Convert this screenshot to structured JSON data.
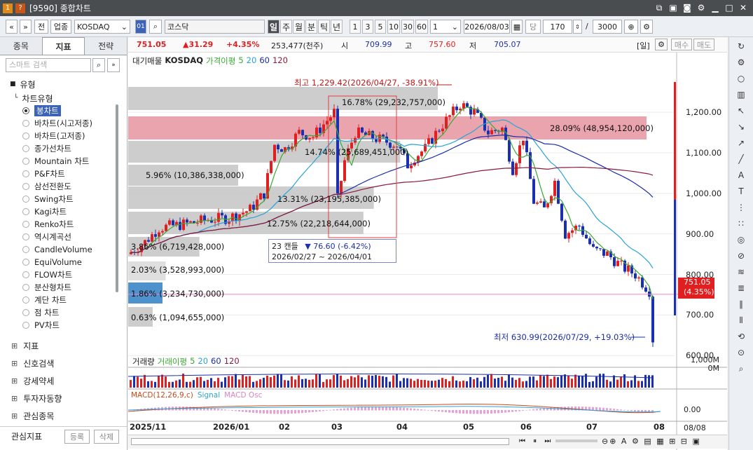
{
  "window": {
    "title": "[9590] 종합차트",
    "num": "1",
    "q": "?"
  },
  "toolbar": {
    "nav_left": "«",
    "nav_down": "»",
    "prev_btn": "전",
    "sector_btn": "업종",
    "market": "KOSDAQ",
    "code_badge": "01",
    "name": "코스닥",
    "periods": [
      "일",
      "주",
      "월",
      "분",
      "틱",
      "년"
    ],
    "nums": [
      "1",
      "3",
      "5",
      "10",
      "30",
      "60"
    ],
    "count": "1",
    "date": "2026/08/03",
    "unit": "당",
    "count2": "170",
    "slash": "/",
    "total": "3000"
  },
  "sidebar": {
    "tabs": [
      "종목",
      "지표",
      "전략"
    ],
    "search_placeholder": "스마트 검색",
    "group_type": "유형",
    "chart_type": "차트유형",
    "chart_items": [
      "봉차트",
      "바차트(시고저종)",
      "바차트(고저종)",
      "종가선차트",
      "Mountain 차트",
      "P&F차트",
      "삼선전환도",
      "Swing차트",
      "Kagi차트",
      "Renko차트",
      "역시계곡선",
      "CandleVolume",
      "EquiVolume",
      "FLOW차트",
      "분산형차트",
      "계단 차트",
      "점 차트",
      "PV차트"
    ],
    "sections": [
      "지표",
      "신호검색",
      "강세약세",
      "투자자동향",
      "관심종목"
    ],
    "bottom_label": "관심지표",
    "register": "등록",
    "delete": "삭제"
  },
  "quote": {
    "price": "751.05",
    "change": "▲31.29",
    "pct": "+4.35%",
    "volume": "253,477(천주)",
    "open_label": "시",
    "open": "709.99",
    "high_label": "고",
    "high": "757.60",
    "low_label": "저",
    "low": "705.07",
    "period": "[일]",
    "buy": "매수",
    "sell": "매도"
  },
  "legend": {
    "main": "대기매물",
    "code": "KOSDAQ",
    "ma_title": "가격이평",
    "ma5": "5",
    "ma20": "20",
    "ma60": "60",
    "ma120": "120"
  },
  "vol_legend": {
    "title": "거래량",
    "ma_title": "거래이평",
    "ma5": "5",
    "ma20": "20",
    "ma60": "60",
    "ma120": "120",
    "y1": "1,000M",
    "y0": "0M"
  },
  "macd_legend": {
    "title": "MACD(12,26,9,c)",
    "signal": "Signal",
    "osc": "MACD Osc",
    "y": "0.00"
  },
  "annotations": {
    "high": "최고 1,229.42(2026/04/27, -38.91%)",
    "low": "최저 630.99(2026/07/29, +19.03%)",
    "tip_count": "23 캔들",
    "tip_change": "▼ 76.60 (-6.42%)",
    "tip_range": "2026/02/27 ~ 2026/04/01",
    "price_tag": "751.05",
    "price_tag_pct": "(4.35%)"
  },
  "profile": [
    {
      "label": "16.78% (29,232,757,000)",
      "pct": 16.78
    },
    {
      "label": "28.09% (48,954,120,000)",
      "pct": 28.09
    },
    {
      "label": "14.74% (25,689,451,000)",
      "pct": 14.74
    },
    {
      "label": "5.96% (10,386,338,000)",
      "pct": 5.96
    },
    {
      "label": "13.31% (23,195,385,000)",
      "pct": 13.31
    },
    {
      "label": "12.75% (22,218,644,000)",
      "pct": 12.75
    },
    {
      "label": "3.86% (6,719,428,000)",
      "pct": 3.86
    },
    {
      "label": "2.03% (3,528,993,000)",
      "pct": 2.03
    },
    {
      "label": "1.86% (3,234,730,000)",
      "pct": 1.86
    },
    {
      "label": "0.63% (1,094,655,000)",
      "pct": 0.63
    }
  ],
  "axis": {
    "y": [
      "1,200.00",
      "1,100.00",
      "1,000.00",
      "900.00",
      "800.00",
      "700.00",
      "600.00"
    ],
    "x": [
      "2025/11",
      "2026/01",
      "02",
      "03",
      "04",
      "05",
      "06",
      "07",
      "08"
    ],
    "x_end": "08/08"
  },
  "colors": {
    "up": "#e02020",
    "down": "#1b2fb0",
    "ma5": "#3aa832",
    "ma20": "#29a3d8",
    "ma60": "#1a2ea8",
    "ma120": "#8b1a3a",
    "accent": "#3b63b7"
  }
}
